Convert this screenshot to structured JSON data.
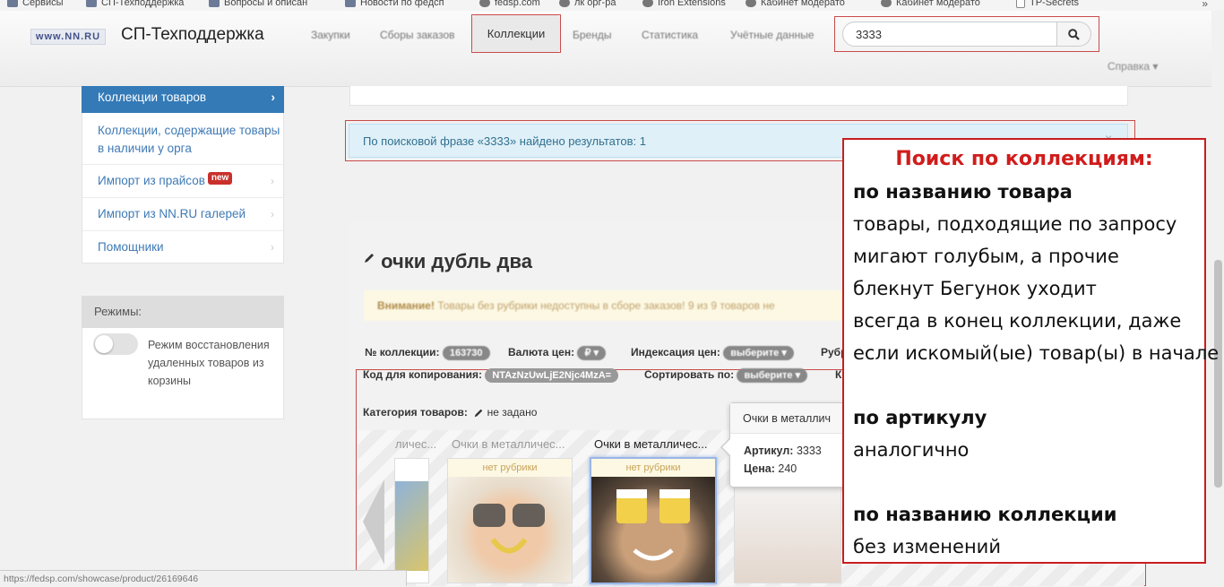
{
  "bookmarks": {
    "items": [
      "Сервисы",
      "СП-Техподдержка",
      "Вопросы и описан",
      "Новости по федсп",
      "fedsp.com",
      "лк орг-ра",
      "Iron Extensions",
      "Кабинет модерато",
      "Кабинет модерато",
      "TP-Secrets"
    ],
    "more": "»"
  },
  "header": {
    "logo": "www.NN.RU",
    "title": "СП-Техподдержка",
    "nav": [
      "Закупки",
      "Сборы заказов",
      "Коллекции",
      "Бренды",
      "Статистика",
      "Учётные данные"
    ],
    "help": "Справка ▾"
  },
  "search": {
    "value": "3333"
  },
  "sidebar": {
    "active_item": "Коллекции товаров",
    "items": [
      "Коллекции, содержащие товары в наличии у орга",
      "Импорт из прайсов",
      "Импорт из NN.RU галерей",
      "Помощники"
    ],
    "new_badge": "new",
    "modes_title": "Режимы:",
    "modes_toggle_label": "Режим восстановления удаленных товаров из корзины",
    "modes_toggle_on": false
  },
  "main": {
    "result_text": "По поисковой фразе «3333» найдено результатов: 1",
    "close": "×",
    "collection_title": "очки дубль два",
    "warning_strong": "Внимание!",
    "warning_text": "Товары без рубрики недоступны в сборе заказов! 9 из 9 товаров не",
    "fields": {
      "collection_no_label": "№ коллекции:",
      "collection_no_value": "163730",
      "currency_label": "Валюта цен:",
      "currency_value": "₽ ▾",
      "indexation_label": "Индексация цен:",
      "indexation_value": "выберите ▾",
      "rubric_label": "Рубр",
      "copy_code_label": "Код для копирования:",
      "copy_code_value": "NTAzNzUwLjE2Njc4MzA=",
      "sort_label": "Сортировать по:",
      "sort_value": "выберите ▾",
      "extra_label": "К"
    },
    "category_label": "Категория товаров:",
    "category_value": "не задано",
    "gallery": {
      "captions": [
        "личес...",
        "Очки в металличес...",
        "Очки в металличес..."
      ],
      "tag": "нет рубрики"
    },
    "tooltip": {
      "title": "Очки в металлич",
      "article_label": "Артикул:",
      "article_value": "3333",
      "price_label": "Цена:",
      "price_value": "240"
    }
  },
  "statusbar": "https://fedsp.com/showcase/product/26169646",
  "note": {
    "title": "Поиск по коллекциям:",
    "section1_head": "по названию товара",
    "section1_lines": [
      "товары, подходящие по запросу",
      "мигают голубым, а прочие",
      "блекнут  Бегунок уходит",
      "всегда в конец коллекции, даже",
      "если искомый(ые) товар(ы) в начале"
    ],
    "section2_head": "по артикулу",
    "section2_text": "аналогично",
    "section3_head": "по названию коллекции",
    "section3_text": "без изменений"
  }
}
